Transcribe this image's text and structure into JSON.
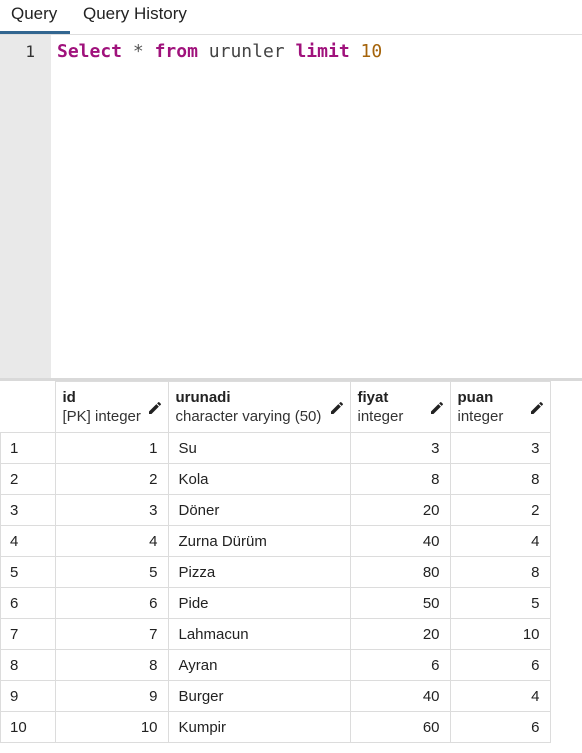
{
  "tabs": {
    "query": "Query",
    "history": "Query History"
  },
  "editor": {
    "line_number": "1",
    "tokens": {
      "select": "Select",
      "star": "*",
      "from": "from",
      "table": "urunler",
      "limit": "limit",
      "limit_value": "10"
    }
  },
  "grid": {
    "columns": [
      {
        "name": "id",
        "type": "[PK] integer"
      },
      {
        "name": "urunadi",
        "type": "character varying (50)"
      },
      {
        "name": "fiyat",
        "type": "integer"
      },
      {
        "name": "puan",
        "type": "integer"
      }
    ],
    "rows": [
      {
        "n": "1",
        "id": "1",
        "urunadi": "Su",
        "fiyat": "3",
        "puan": "3"
      },
      {
        "n": "2",
        "id": "2",
        "urunadi": "Kola",
        "fiyat": "8",
        "puan": "8"
      },
      {
        "n": "3",
        "id": "3",
        "urunadi": "Döner",
        "fiyat": "20",
        "puan": "2"
      },
      {
        "n": "4",
        "id": "4",
        "urunadi": "Zurna Dürüm",
        "fiyat": "40",
        "puan": "4"
      },
      {
        "n": "5",
        "id": "5",
        "urunadi": "Pizza",
        "fiyat": "80",
        "puan": "8"
      },
      {
        "n": "6",
        "id": "6",
        "urunadi": "Pide",
        "fiyat": "50",
        "puan": "5"
      },
      {
        "n": "7",
        "id": "7",
        "urunadi": "Lahmacun",
        "fiyat": "20",
        "puan": "10"
      },
      {
        "n": "8",
        "id": "8",
        "urunadi": "Ayran",
        "fiyat": "6",
        "puan": "6"
      },
      {
        "n": "9",
        "id": "9",
        "urunadi": "Burger",
        "fiyat": "40",
        "puan": "4"
      },
      {
        "n": "10",
        "id": "10",
        "urunadi": "Kumpir",
        "fiyat": "60",
        "puan": "6"
      }
    ]
  },
  "icons": {
    "edit": "pencil-icon"
  },
  "colors": {
    "tab_active": "#326690",
    "keyword": "#a0127c",
    "number": "#a5640b"
  }
}
